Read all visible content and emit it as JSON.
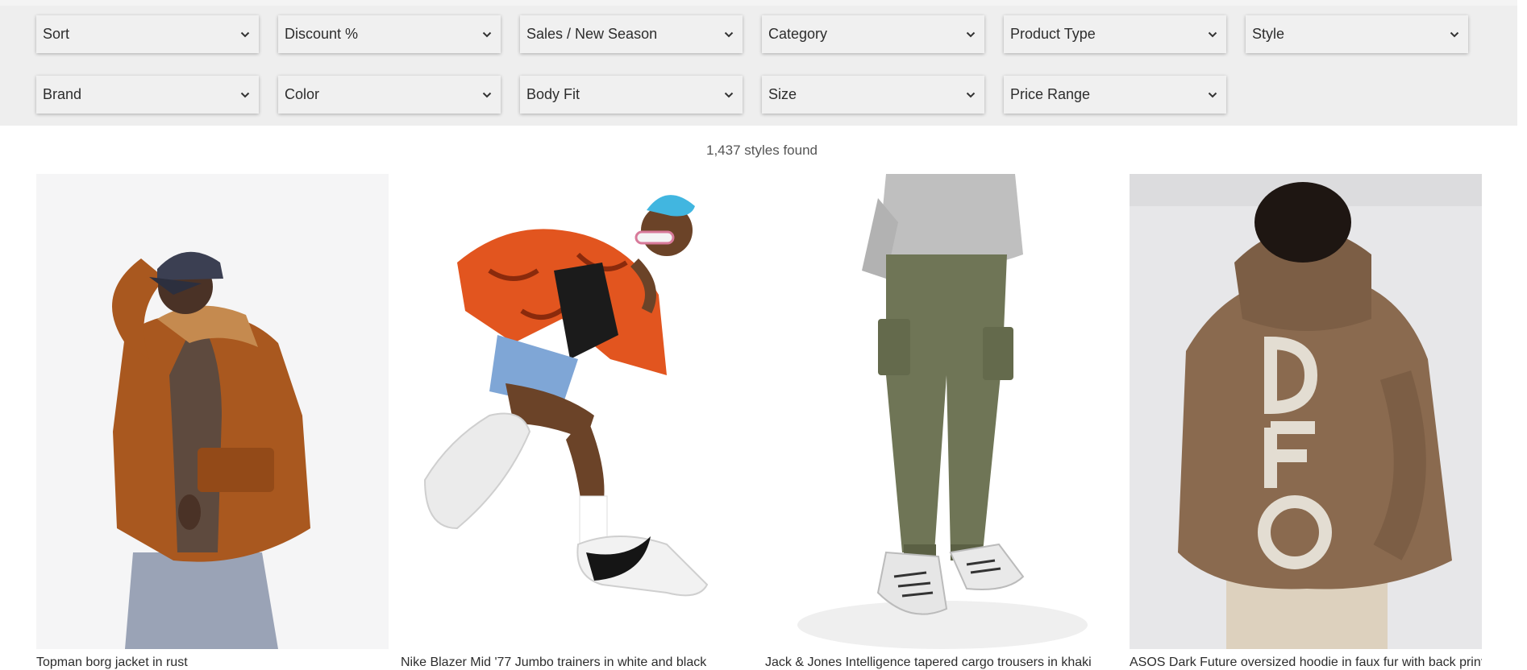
{
  "filters": {
    "row1": [
      {
        "label": "Sort"
      },
      {
        "label": "Discount %"
      },
      {
        "label": "Sales / New Season"
      },
      {
        "label": "Category"
      },
      {
        "label": "Product Type"
      },
      {
        "label": "Style"
      }
    ],
    "row2": [
      {
        "label": "Brand"
      },
      {
        "label": "Color"
      },
      {
        "label": "Body Fit"
      },
      {
        "label": "Size"
      },
      {
        "label": "Price Range"
      }
    ],
    "chevron_icon": "chevron-down-icon"
  },
  "results": {
    "count_text": "1,437 styles found"
  },
  "products": [
    {
      "name": "Topman borg jacket in rust",
      "image": "model in rust borg jacket and cap",
      "accent": "#b5652a"
    },
    {
      "name": "Nike Blazer Mid '77 Jumbo trainers in white and black",
      "image": "model jumping in white sneakers",
      "accent": "#e2551f"
    },
    {
      "name": "Jack & Jones Intelligence tapered cargo trousers in khaki",
      "image": "model in khaki cargo trousers",
      "accent": "#6f7556"
    },
    {
      "name": "ASOS Dark Future oversized hoodie in faux fur with back print",
      "image": "model in brown faux fur hoodie",
      "accent": "#8a6a4f"
    }
  ]
}
